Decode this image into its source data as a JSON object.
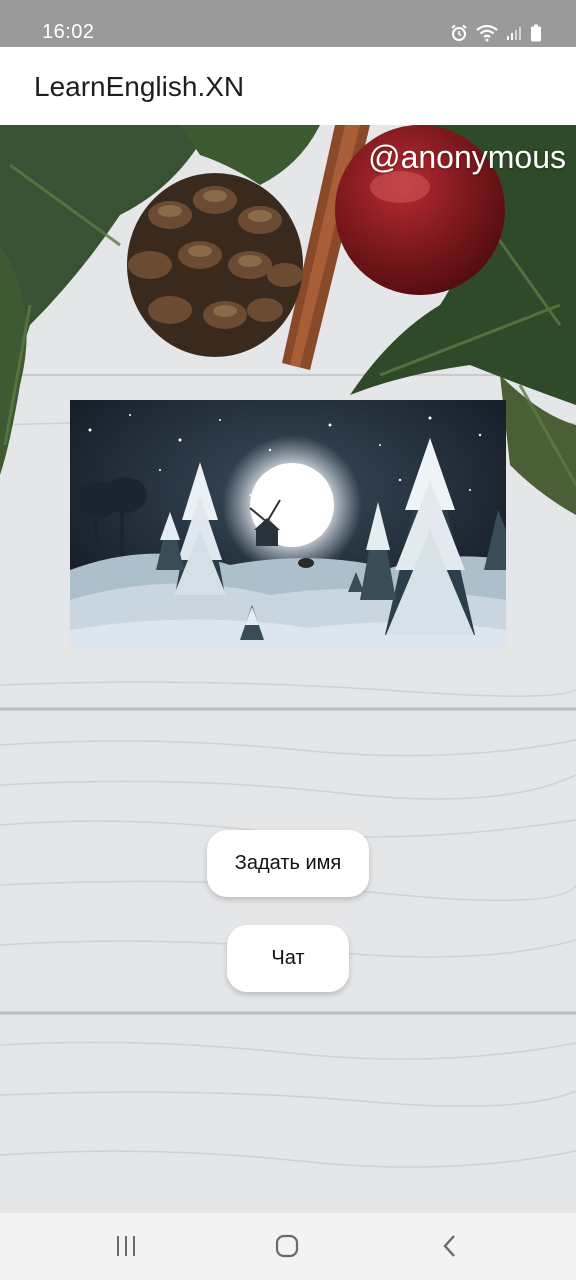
{
  "status_bar": {
    "time": "16:02",
    "icons": [
      "alarm-icon",
      "wifi-icon",
      "signal-icon",
      "battery-icon"
    ]
  },
  "app_bar": {
    "title": "LearnEnglish.XN"
  },
  "main": {
    "username": "@anonymous",
    "image": "winter-night-scene",
    "buttons": {
      "set_name": "Задать имя",
      "chat": "Чат"
    }
  },
  "nav_bar": {
    "icons": [
      "recents-icon",
      "home-icon",
      "back-icon"
    ]
  },
  "colors": {
    "status_bar_bg": "#9a9a9a",
    "app_bar_bg": "#ffffff",
    "button_bg": "#ffffff",
    "nav_bar_bg": "#f3f3f3"
  }
}
